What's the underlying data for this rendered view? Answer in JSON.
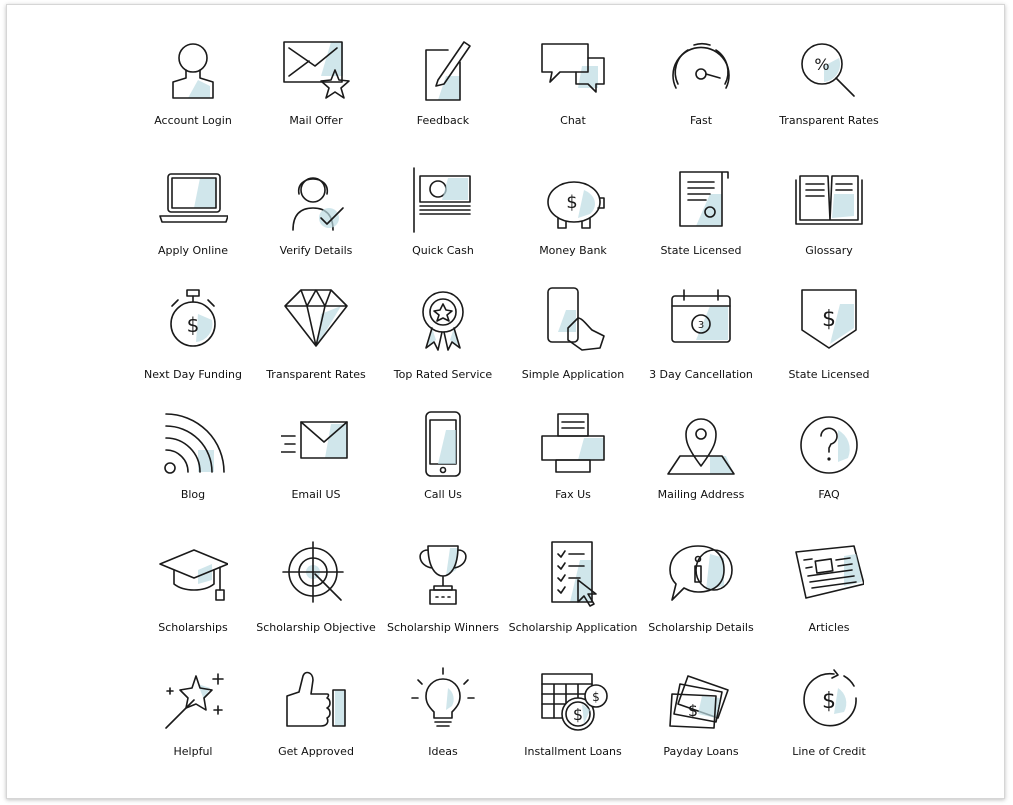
{
  "colors": {
    "stroke": "#1a1a1a",
    "accent": "#bcdbe3"
  },
  "icons": [
    {
      "label": "Account Login",
      "icon": "user-icon"
    },
    {
      "label": "Mail Offer",
      "icon": "envelope-star-icon"
    },
    {
      "label": "Feedback",
      "icon": "pencil-note-icon"
    },
    {
      "label": "Chat",
      "icon": "chat-bubbles-icon"
    },
    {
      "label": "Fast",
      "icon": "speedometer-icon"
    },
    {
      "label": "Transparent Rates",
      "icon": "magnifier-percent-icon"
    },
    {
      "label": "Apply Online",
      "icon": "laptop-icon"
    },
    {
      "label": "Verify Details",
      "icon": "woman-check-icon"
    },
    {
      "label": "Quick Cash",
      "icon": "cash-stack-icon"
    },
    {
      "label": "Money Bank",
      "icon": "piggy-bank-icon"
    },
    {
      "label": "State Licensed",
      "icon": "certificate-scroll-icon"
    },
    {
      "label": "Glossary",
      "icon": "open-book-icon"
    },
    {
      "label": "Next Day Funding",
      "icon": "stopwatch-dollar-icon"
    },
    {
      "label": "Transparent Rates",
      "icon": "diamond-icon"
    },
    {
      "label": "Top Rated Service",
      "icon": "award-ribbon-icon"
    },
    {
      "label": "Simple Application",
      "icon": "hand-phone-icon"
    },
    {
      "label": "3 Day Cancellation",
      "icon": "calendar-3-icon"
    },
    {
      "label": "State Licensed",
      "icon": "shield-dollar-icon"
    },
    {
      "label": "Blog",
      "icon": "rss-icon"
    },
    {
      "label": "Email US",
      "icon": "envelope-fast-icon"
    },
    {
      "label": "Call Us",
      "icon": "smartphone-icon"
    },
    {
      "label": "Fax Us",
      "icon": "fax-icon"
    },
    {
      "label": "Mailing Address",
      "icon": "map-pin-icon"
    },
    {
      "label": "FAQ",
      "icon": "question-circle-icon"
    },
    {
      "label": "Scholarships",
      "icon": "graduation-cap-icon"
    },
    {
      "label": "Scholarship Objective",
      "icon": "target-icon"
    },
    {
      "label": "Scholarship Winners",
      "icon": "trophy-icon"
    },
    {
      "label": "Scholarship Application",
      "icon": "checklist-cursor-icon"
    },
    {
      "label": "Scholarship Details",
      "icon": "info-bubble-icon"
    },
    {
      "label": "Articles",
      "icon": "newspaper-icon"
    },
    {
      "label": "Helpful",
      "icon": "magic-wand-icon"
    },
    {
      "label": "Get Approved",
      "icon": "thumbs-up-icon"
    },
    {
      "label": "Ideas",
      "icon": "lightbulb-icon"
    },
    {
      "label": "Installment Loans",
      "icon": "calendar-coins-icon"
    },
    {
      "label": "Payday Loans",
      "icon": "banknotes-icon"
    },
    {
      "label": "Line of Credit",
      "icon": "circular-dollar-icon"
    }
  ]
}
